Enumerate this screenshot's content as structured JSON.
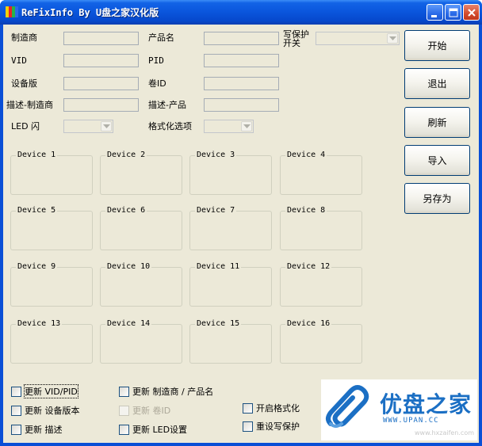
{
  "window": {
    "title": "ReFixInfo By U盘之家汉化版"
  },
  "fields": {
    "manufacturer": {
      "label": "制造商",
      "value": ""
    },
    "product_name": {
      "label": "产品名",
      "value": ""
    },
    "write_protect_switch": {
      "label": "写保护\n开关",
      "value": ""
    },
    "vid": {
      "label": "VID",
      "value": ""
    },
    "pid": {
      "label": "PID",
      "value": ""
    },
    "device_version": {
      "label": "设备版",
      "value": ""
    },
    "volume_id": {
      "label": "卷ID",
      "value": ""
    },
    "desc_manufacturer": {
      "label": "描述-制造商",
      "value": ""
    },
    "desc_product": {
      "label": "描述-产品",
      "value": ""
    },
    "led_flash": {
      "label": "LED 闪",
      "value": ""
    },
    "format_options": {
      "label": "格式化选项",
      "value": ""
    }
  },
  "buttons": {
    "start": "开始",
    "exit": "退出",
    "refresh": "刷新",
    "import": "导入",
    "save_as": "另存为"
  },
  "devices": [
    "Device 1",
    "Device 2",
    "Device 3",
    "Device 4",
    "Device 5",
    "Device 6",
    "Device 7",
    "Device 8",
    "Device 9",
    "Device 10",
    "Device 11",
    "Device 12",
    "Device 13",
    "Device 14",
    "Device 15",
    "Device 16"
  ],
  "checkboxes": {
    "update_vid_pid": {
      "label": "更新 VID/PID",
      "checked": false
    },
    "update_manufacturer_product": {
      "label": "更新 制造商 / 产品名",
      "checked": false
    },
    "update_device_version": {
      "label": "更新 设备版本",
      "checked": false
    },
    "update_volume_id": {
      "label": "更新 卷ID",
      "checked": false,
      "disabled": true
    },
    "enable_format": {
      "label": "开启格式化",
      "checked": false
    },
    "update_description": {
      "label": "更新 描述",
      "checked": false
    },
    "update_led": {
      "label": "更新 LED设置",
      "checked": false
    },
    "reset_write_protect": {
      "label": "重设写保护",
      "checked": false
    }
  },
  "logo": {
    "brand": "优盘之家",
    "url": "WWW.UPAN.CC",
    "watermark": "www.hxzaifen.com"
  },
  "colors": {
    "titlebar": "#0a55dc",
    "face": "#ece9d8",
    "button_border": "#003c74",
    "logo_blue": "#1b6fc4"
  }
}
